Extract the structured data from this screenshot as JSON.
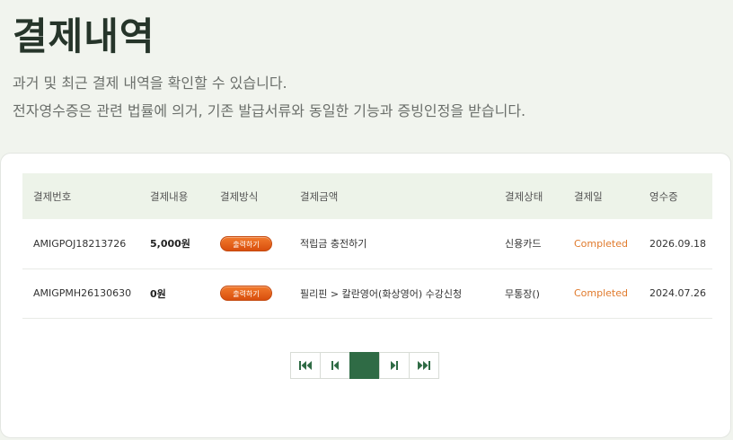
{
  "header": {
    "title": "결제내역",
    "desc1": "과거 및 최근 결제 내역을 확인할 수 있습니다.",
    "desc2": "전자영수증은 관련 법률에 의거, 기존 발급서류와 동일한 기능과 증빙인정을 받습니다."
  },
  "table": {
    "columns": [
      "결제번호",
      "결제내용",
      "결제방식",
      "결제금액",
      "결제상태",
      "결제일",
      "영수증"
    ],
    "rows": [
      {
        "id": "AMIGPOJ18213726",
        "amount": "5,000원",
        "button": "출력하기",
        "content": "적립금 충전하기",
        "method": "신용카드",
        "status": "Completed",
        "date": "2026.09.18"
      },
      {
        "id": "AMIGPMH26130630",
        "amount": "0원",
        "button": "출력하기",
        "content": "필리핀 > 칼란영어(화상영어) 수강신청",
        "method": "무통장()",
        "status": "Completed",
        "date": "2024.07.26"
      }
    ]
  },
  "pager": {
    "current_page": "",
    "icons": [
      "first-page-icon",
      "prev-page-icon",
      "next-page-icon",
      "last-page-icon"
    ]
  },
  "colors": {
    "accent": "#2f6b45",
    "status": "#e07a2c",
    "button": "#e8641e"
  }
}
